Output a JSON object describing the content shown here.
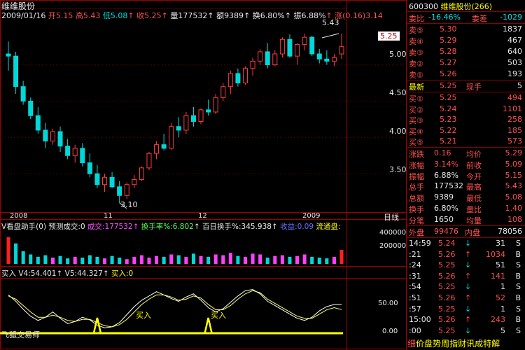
{
  "stock": {
    "name": "维维股份",
    "code": "600300",
    "code_name": "维维股份(266)"
  },
  "quote_bar": {
    "date": "2009/01/16",
    "open_label": "开",
    "open": "5.15",
    "high_label": "高",
    "high": "5.43",
    "low_label": "低",
    "low": "5.08",
    "close_label": "收",
    "close": "5.25",
    "volume_label": "量",
    "volume": "177532",
    "amount_label": "额",
    "amount": "9389",
    "turnover_label": "换",
    "turnover": "6.80%",
    "amplitude_label": "振",
    "amplitude": "6.88%",
    "change_label": "涨",
    "change": "(0.16)",
    "change_pct": "3.14"
  },
  "price_axis": [
    "5.00",
    "4.50",
    "4.00",
    "3.50"
  ],
  "current_price_tag": "5.25",
  "annotations": {
    "high_mark": "5.43",
    "low_mark": "3.10"
  },
  "x_axis": [
    "2008",
    "11",
    "12",
    "2009"
  ],
  "period_label": "日线",
  "volume_panel": {
    "title": "V看盘助手(0)",
    "predict_label": "预测成交:0",
    "vol_label": "成交:",
    "vol_value": "177532",
    "turn_label": "换手率%:",
    "turn_value": "6.802",
    "hundred_label": "百日换手%:",
    "hundred_value": "345.938",
    "gain_label": "收益:",
    "gain_value": "0.09",
    "flow_label": "流通盘:",
    "axis": [
      "400000",
      "200000"
    ]
  },
  "indicator_panel": {
    "title": "买入",
    "v4_label": "V4:",
    "v4_value": "54.401",
    "v5_label": "V5:",
    "v5_value": "44.327",
    "buy_label": "买入:",
    "buy_value": "0",
    "axis": [
      "50.00",
      "0.00"
    ],
    "signal_labels": [
      "买入",
      "买入"
    ],
    "brand": "飞狐交易师"
  },
  "right_panel": {
    "ratio_label": "委比",
    "ratio_value": "-16.46%",
    "diff_label": "委差",
    "diff_value": "-1029",
    "asks": [
      {
        "label": "卖⑤",
        "price": "5.30",
        "vol": "1837"
      },
      {
        "label": "卖④",
        "price": "5.29",
        "vol": "467"
      },
      {
        "label": "卖③",
        "price": "5.28",
        "vol": "640"
      },
      {
        "label": "卖②",
        "price": "5.27",
        "vol": "503"
      },
      {
        "label": "卖①",
        "price": "5.26",
        "vol": "193"
      }
    ],
    "last_label": "最新",
    "last_price": "5.25",
    "now_label": "现手",
    "now_value": "5",
    "bids": [
      {
        "label": "买①",
        "price": "5.25",
        "vol": "494"
      },
      {
        "label": "买②",
        "price": "5.24",
        "vol": "1101"
      },
      {
        "label": "买③",
        "price": "5.23",
        "vol": "258"
      },
      {
        "label": "买④",
        "price": "5.22",
        "vol": "185"
      },
      {
        "label": "买⑤",
        "price": "5.21",
        "vol": "573"
      }
    ],
    "stats": [
      {
        "k1": "涨跌",
        "v1": "0.16",
        "k2": "均价",
        "v2": "5.29"
      },
      {
        "k1": "涨幅",
        "v1": "3.14%",
        "k2": "前收",
        "v2": "5.09"
      },
      {
        "k1": "振幅",
        "v1": "6.88%",
        "k2": "今开",
        "v2": "5.15"
      },
      {
        "k1": "总手",
        "v1": "177532",
        "k2": "最高",
        "v2": "5.43"
      },
      {
        "k1": "总额",
        "v1": "9389",
        "k2": "最低",
        "v2": "5.08"
      },
      {
        "k1": "换手",
        "v1": "6.80%",
        "k2": "量比",
        "v2": "1.40"
      },
      {
        "k1": "分笔",
        "v1": "1650",
        "k2": "均量",
        "v2": "108"
      }
    ],
    "outer_label": "外盘",
    "outer_value": "99476",
    "inner_label": "内盘",
    "inner_value": "78056",
    "ticks": [
      {
        "time": "14:59",
        "price": "5.24",
        "dir": "↓",
        "vol": "31",
        "side": "S"
      },
      {
        "time": ":21",
        "price": "5.26",
        "dir": "↑",
        "vol": "1034",
        "side": "B"
      },
      {
        "time": ":24",
        "price": "5.25",
        "dir": "↓",
        "vol": "51",
        "side": "S"
      },
      {
        "time": ":31",
        "price": "5.26",
        "dir": "↑",
        "vol": "141",
        "side": "B"
      },
      {
        "time": ":54",
        "price": "5.25",
        "dir": "↓",
        "vol": "1",
        "side": "S"
      },
      {
        "time": ":51",
        "price": "5.26",
        "dir": "↑",
        "vol": "52",
        "side": "B"
      },
      {
        "time": ":57",
        "price": "5.25",
        "dir": "↓",
        "vol": "1",
        "side": "S"
      },
      {
        "time": "15:00",
        "price": "5.26",
        "dir": "↑",
        "vol": "243",
        "side": "B"
      },
      {
        "time": ":00",
        "price": "5.25",
        "dir": "↓",
        "vol": "5",
        "side": "S"
      }
    ],
    "tabs": [
      "细",
      "价",
      "盘",
      "势",
      "周",
      "指",
      "财",
      "讯",
      "成",
      "特",
      "解"
    ]
  },
  "colors": {
    "up": "#ff3c3c",
    "down": "#00d8d8",
    "border": "#a00000",
    "yellow": "#ffff00",
    "magenta": "#ff40ff"
  },
  "chart_data": {
    "type": "candlestick",
    "title": "维维股份",
    "ylabel": "",
    "ylim": [
      3.0,
      5.7
    ],
    "series": [
      {
        "name": "price",
        "values": [
          [
            5.15,
            5.32,
            4.92,
            5.12
          ],
          [
            5.12,
            5.18,
            4.6,
            4.7
          ],
          [
            4.7,
            4.78,
            4.45,
            4.5
          ],
          [
            4.5,
            4.55,
            4.25,
            4.3
          ],
          [
            4.3,
            4.42,
            4.05,
            4.1
          ],
          [
            4.1,
            4.2,
            3.85,
            3.95
          ],
          [
            3.95,
            4.12,
            3.9,
            4.08
          ],
          [
            4.08,
            4.15,
            3.8,
            3.88
          ],
          [
            3.88,
            3.98,
            3.7,
            3.75
          ],
          [
            3.75,
            3.9,
            3.65,
            3.85
          ],
          [
            3.85,
            3.92,
            3.6,
            3.65
          ],
          [
            3.65,
            3.78,
            3.45,
            3.5
          ],
          [
            3.5,
            3.62,
            3.3,
            3.35
          ],
          [
            3.35,
            3.5,
            3.25,
            3.45
          ],
          [
            3.45,
            3.52,
            3.3,
            3.32
          ],
          [
            3.32,
            3.4,
            3.1,
            3.2
          ],
          [
            3.2,
            3.38,
            3.15,
            3.35
          ],
          [
            3.35,
            3.48,
            3.3,
            3.42
          ],
          [
            3.42,
            3.6,
            3.4,
            3.58
          ],
          [
            3.58,
            3.8,
            3.55,
            3.78
          ],
          [
            3.78,
            3.95,
            3.7,
            3.9
          ],
          [
            3.9,
            4.05,
            3.82,
            3.85
          ],
          [
            3.85,
            4.2,
            3.83,
            4.15
          ],
          [
            4.15,
            4.28,
            4.0,
            4.1
          ],
          [
            4.1,
            4.35,
            4.05,
            4.3
          ],
          [
            4.3,
            4.42,
            4.15,
            4.22
          ],
          [
            4.22,
            4.4,
            4.18,
            4.38
          ],
          [
            4.38,
            4.52,
            4.3,
            4.35
          ],
          [
            4.35,
            4.6,
            4.32,
            4.55
          ],
          [
            4.55,
            4.75,
            4.5,
            4.7
          ],
          [
            4.7,
            4.92,
            4.6,
            4.88
          ],
          [
            4.88,
            4.95,
            4.7,
            4.75
          ],
          [
            4.75,
            4.98,
            4.72,
            4.95
          ],
          [
            4.95,
            5.1,
            4.85,
            5.05
          ],
          [
            5.05,
            5.22,
            5.0,
            5.18
          ],
          [
            5.18,
            5.3,
            4.95,
            5.0
          ],
          [
            5.0,
            5.2,
            4.98,
            5.15
          ],
          [
            5.15,
            5.38,
            5.1,
            5.35
          ],
          [
            5.35,
            5.42,
            5.1,
            5.12
          ],
          [
            5.12,
            5.3,
            5.0,
            5.28
          ],
          [
            5.28,
            5.43,
            5.2,
            5.38
          ],
          [
            5.38,
            5.4,
            5.12,
            5.15
          ],
          [
            5.15,
            5.22,
            5.02,
            5.08
          ],
          [
            5.08,
            5.2,
            5.0,
            5.05
          ],
          [
            5.05,
            5.15,
            4.98,
            5.1
          ],
          [
            5.15,
            5.43,
            5.08,
            5.25
          ]
        ]
      },
      {
        "name": "volume",
        "values": [
          340000,
          260000,
          160000,
          120000,
          90000,
          110000,
          80000,
          100000,
          70000,
          90000,
          80000,
          110000,
          90000,
          70000,
          100000,
          80000,
          60000,
          90000,
          110000,
          80000,
          100000,
          90000,
          120000,
          110000,
          90000,
          130000,
          100000,
          90000,
          120000,
          110000,
          140000,
          100000,
          90000,
          130000,
          120000,
          80000,
          100000,
          110000,
          90000,
          100000,
          120000,
          90000,
          80000,
          70000,
          90000,
          177532
        ]
      },
      {
        "name": "V4",
        "values": [
          72,
          60,
          45,
          32,
          24,
          30,
          40,
          28,
          18,
          22,
          30,
          25,
          15,
          10,
          12,
          20,
          35,
          50,
          62,
          70,
          78,
          72,
          65,
          60,
          68,
          74,
          62,
          48,
          40,
          46,
          58,
          70,
          80,
          82,
          74,
          60,
          52,
          44,
          36,
          28,
          24,
          30,
          42,
          50,
          54,
          54.401
        ]
      },
      {
        "name": "V5",
        "values": [
          70,
          64,
          52,
          40,
          30,
          30,
          34,
          30,
          24,
          22,
          26,
          26,
          20,
          14,
          12,
          16,
          26,
          40,
          54,
          64,
          72,
          72,
          68,
          62,
          64,
          70,
          66,
          54,
          44,
          44,
          52,
          64,
          74,
          80,
          76,
          64,
          56,
          48,
          40,
          32,
          28,
          28,
          36,
          44,
          48,
          44.327
        ]
      }
    ]
  }
}
